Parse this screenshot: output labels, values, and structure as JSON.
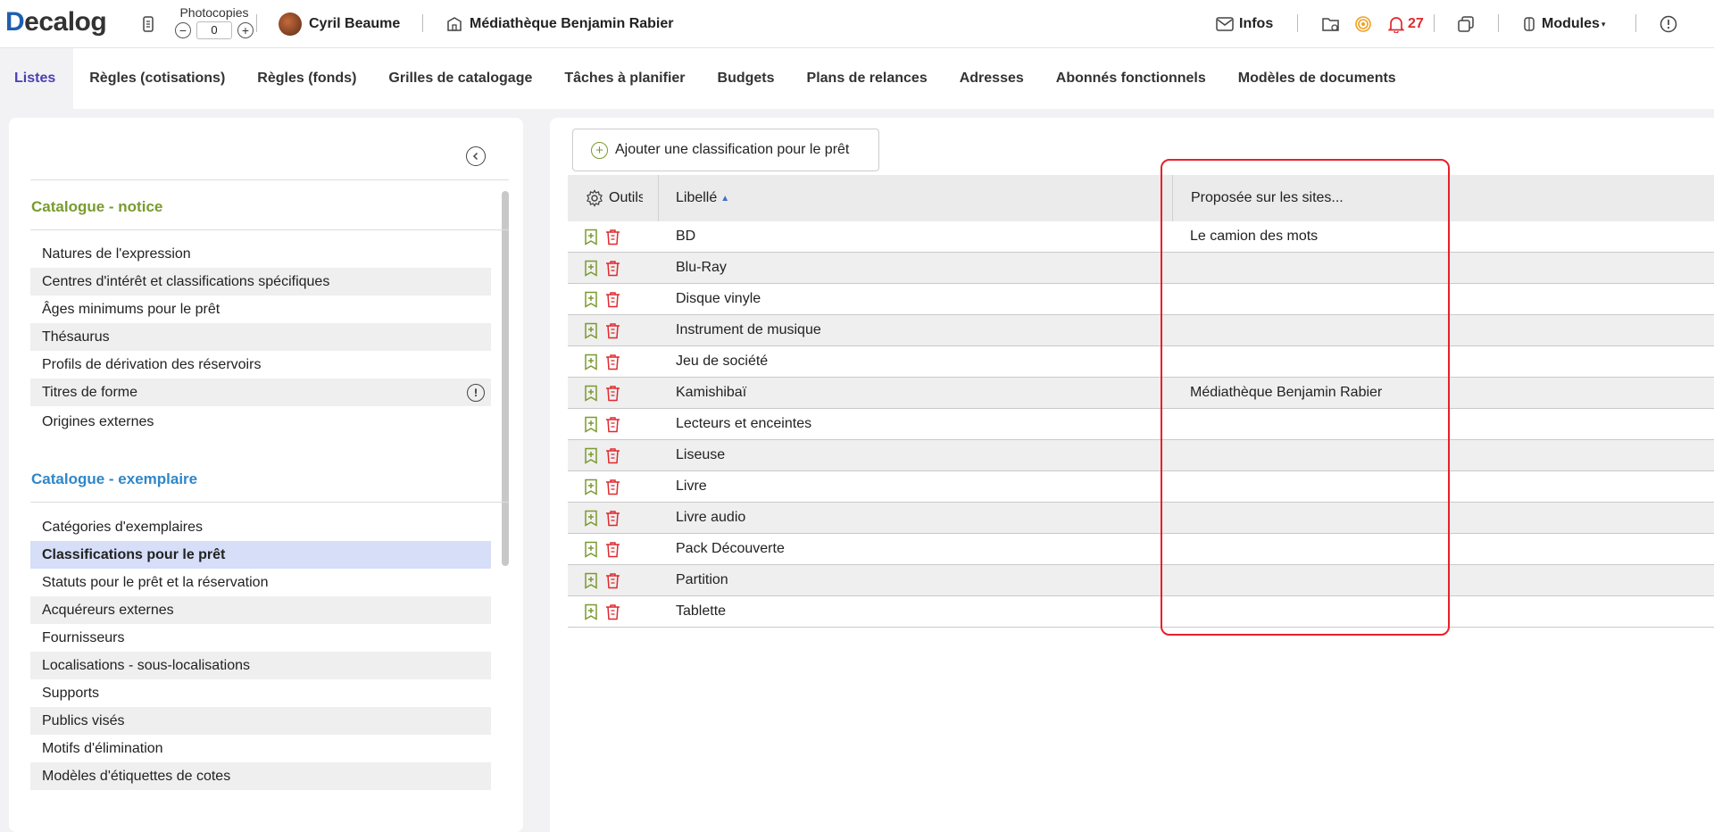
{
  "app": {
    "logo_text": "ecalog",
    "logo_first": "D"
  },
  "topbar": {
    "photocopies_label": "Photocopies",
    "photocopies_value": "0",
    "user_name": "Cyril Beaume",
    "library_name": "Médiathèque Benjamin Rabier",
    "infos_label": "Infos",
    "notifications_count": "27",
    "modules_label": "Modules"
  },
  "tabs": [
    {
      "label": "Listes",
      "active": true
    },
    {
      "label": "Règles (cotisations)"
    },
    {
      "label": "Règles (fonds)"
    },
    {
      "label": "Grilles de catalogage"
    },
    {
      "label": "Tâches à planifier"
    },
    {
      "label": "Budgets"
    },
    {
      "label": "Plans de relances"
    },
    {
      "label": "Adresses"
    },
    {
      "label": "Abonnés fonctionnels"
    },
    {
      "label": "Modèles de documents"
    }
  ],
  "sidebar": {
    "section_notice": {
      "title": "Catalogue - notice",
      "items": [
        "Natures de l'expression",
        "Centres d'intérêt et classifications spécifiques",
        "Âges minimums pour le prêt",
        "Thésaurus",
        "Profils de dérivation des réservoirs",
        "Titres de forme",
        "Origines externes"
      ]
    },
    "section_exemplaire": {
      "title": "Catalogue - exemplaire",
      "items": [
        "Catégories d'exemplaires",
        "Classifications pour le prêt",
        "Statuts pour le prêt et la réservation",
        "Acquéreurs externes",
        "Fournisseurs",
        "Localisations - sous-localisations",
        "Supports",
        "Publics visés",
        "Motifs d'élimination",
        "Modèles d'étiquettes de cotes"
      ],
      "selected": "Classifications pour le prêt"
    }
  },
  "main": {
    "add_button_label": "Ajouter une classification pour le prêt",
    "columns": {
      "tools": "Outils",
      "label": "Libellé",
      "sites": "Proposée sur les sites..."
    },
    "rows": [
      {
        "label": "BD",
        "sites": "Le camion des mots"
      },
      {
        "label": "Blu-Ray",
        "sites": ""
      },
      {
        "label": "Disque vinyle",
        "sites": ""
      },
      {
        "label": "Instrument de musique",
        "sites": ""
      },
      {
        "label": "Jeu de société",
        "sites": ""
      },
      {
        "label": "Kamishibaï",
        "sites": "Médiathèque Benjamin Rabier"
      },
      {
        "label": "Lecteurs et enceintes",
        "sites": ""
      },
      {
        "label": "Liseuse",
        "sites": ""
      },
      {
        "label": "Livre",
        "sites": ""
      },
      {
        "label": "Livre audio",
        "sites": ""
      },
      {
        "label": "Pack Découverte",
        "sites": ""
      },
      {
        "label": "Partition",
        "sites": ""
      },
      {
        "label": "Tablette",
        "sites": ""
      }
    ]
  },
  "colors": {
    "accent": "#4a3fb3",
    "green": "#7a9a2f",
    "blue": "#2f86c9",
    "alert": "#e0282e",
    "highlight": "#e8202a"
  }
}
